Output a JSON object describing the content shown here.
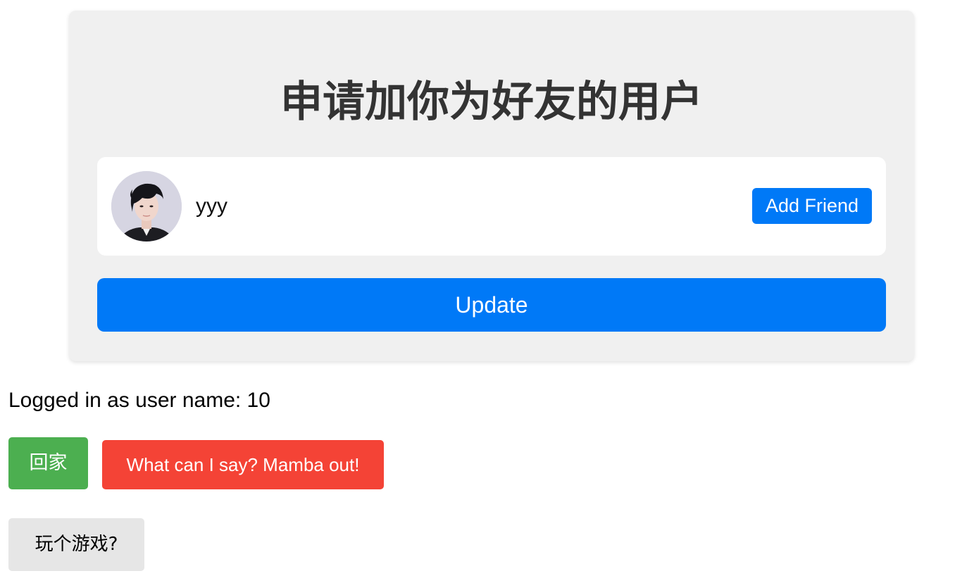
{
  "card": {
    "title": "申请加你为好友的用户",
    "requests": [
      {
        "username": "yyy",
        "avatar_icon": "user-avatar-photo",
        "add_label": "Add Friend"
      }
    ],
    "update_label": "Update"
  },
  "status": {
    "logged_in_text": "Logged in as user name: 10"
  },
  "actions": {
    "home_label": "回家",
    "mamba_label": "What can I say? Mamba out!",
    "game_label": "玩个游戏?"
  },
  "colors": {
    "primary_blue": "#0079f7",
    "home_green": "#4caf50",
    "mamba_red": "#f44336",
    "game_gray": "#e6e6e6",
    "card_bg": "#f0f0f0",
    "title_text": "#333333"
  }
}
